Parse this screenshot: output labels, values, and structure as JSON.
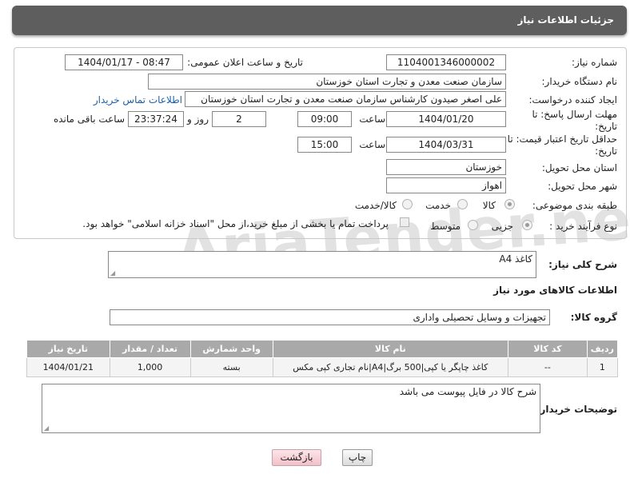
{
  "header": {
    "title": "جزئیات اطلاعات نیاز"
  },
  "watermark": {
    "text": "AriaTender.neT"
  },
  "fields": {
    "need_number": {
      "label": "شماره نیاز:",
      "value": "1104001346000002"
    },
    "announce_datetime": {
      "label": "تاریخ و ساعت اعلان عمومی:",
      "value": "1404/01/17 - 08:47"
    },
    "buyer_org": {
      "label": "نام دستگاه خریدار:",
      "value": "سازمان صنعت معدن و تجارت استان خوزستان"
    },
    "requester": {
      "label": "ایجاد کننده درخواست:",
      "value": "علی اصغر صیدون کارشناس سازمان صنعت معدن و تجارت استان خوزستان"
    },
    "buyer_contact_link": "اطلاعات تماس خریدار",
    "response_deadline": {
      "label": "مهلت ارسال پاسخ: تا تاریخ:",
      "date": "1404/01/20",
      "time_label": "ساعت",
      "time": "09:00",
      "days": "2",
      "days_label": "روز و",
      "remaining": "23:37:24",
      "remaining_label": "ساعت باقی مانده"
    },
    "price_validity": {
      "label": "حداقل تاریخ اعتبار قیمت: تا تاریخ:",
      "date": "1404/03/31",
      "time_label": "ساعت",
      "time": "15:00"
    },
    "delivery_province": {
      "label": "استان محل تحویل:",
      "value": "خوزستان"
    },
    "delivery_city": {
      "label": "شهر محل تحویل:",
      "value": "اهواز"
    },
    "category": {
      "label": "طبقه بندی موضوعی:",
      "options": [
        "کالا",
        "خدمت",
        "کالا/خدمت"
      ],
      "selected": "کالا"
    },
    "purchase_type": {
      "label": "نوع فرآیند خرید :",
      "options": [
        "جزیی",
        "متوسط"
      ],
      "selected": "جزیی",
      "payment_note": "پرداخت تمام یا بخشی از مبلغ خرید،از محل \"اسناد خزانه اسلامی\" خواهد بود."
    }
  },
  "summary": {
    "label": "شرح کلی نیاز:",
    "value": "کاغذ A4"
  },
  "items_section": {
    "title": "اطلاعات کالاهای مورد نیاز",
    "group_label": "گروه کالا:",
    "group_value": "تجهیزات و وسایل تحصیلی واداری"
  },
  "table": {
    "headers": [
      "ردیف",
      "کد کالا",
      "نام کالا",
      "واحد شمارش",
      "تعداد / مقدار",
      "تاریخ نیاز"
    ],
    "rows": [
      [
        "1",
        "--",
        "کاغذ چاپگر یا کپی|500 برگ|A4|نام تجاری کپی مکس",
        "بسته",
        "1,000",
        "1404/01/21"
      ]
    ]
  },
  "buyer_notes": {
    "label": "توضیحات خریدار:",
    "value": "شرح کالا در فایل پیوست می باشد"
  },
  "buttons": {
    "print": "چاپ",
    "back": "بازگشت"
  }
}
